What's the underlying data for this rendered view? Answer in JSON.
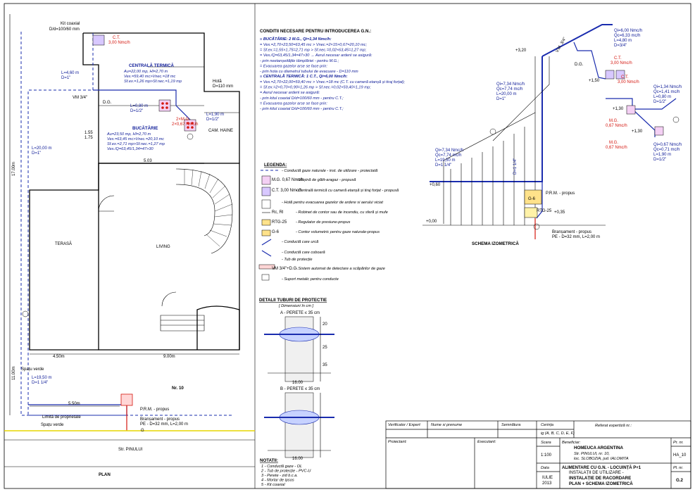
{
  "conditions": {
    "title": "CONDITII NECESARE PENTRU INTRODUCEREA G.N.:",
    "kitchen_head": "≡ BUCĂTĂRIE: 2 M.G., Qi=1,34 Nmc/h:",
    "kitchen_lines": [
      "= Vex.=2,70×23,50=63,45 mc > Vnec.=2×15×0,67=20,10 mc;",
      "= Sf.ex.=1,55×1,75=2,71 mp > Sf.nec.=0,02×63,45=1,27 mp;",
      "= Vex./Q=63,45/1,34=47>30 → Aerul necesar arderii se asigură:",
      "- prin neetanșeitățile tâmplăriei - pentru M.G.;",
      "= Evacuarea gazelor arse se face prin:",
      "- prin hota cu diametrul tubului de evacuare - D=110 mm"
    ],
    "boiler_head": "≡ CENTRALĂ TERMICĂ: 1 C.T., Qi=6,00 Nmc/h:",
    "boiler_lines": [
      "= Vex.=2,70×22,00=59,40 mc > Vnec.=18 mc (C.T. cu cameră etanșă și tiraj forțat);",
      "= Sf.ex.=2×0,70×0,90=1,26 mp > Sf.nec.=0,02×59,40=1,19 mp;",
      "= Aerul necesar arderii se asigură:",
      "- prin kitul coaxial D/d=100/60 mm - pentru C.T.;",
      "= Evacuarea gazelor arse se face prin:",
      "- prin kitul coaxial D/d=100/60 mm - pentru C.T.;"
    ]
  },
  "legend": {
    "title": "LEGENDA:",
    "items": [
      {
        "symbol": "",
        "text": "- Conductă gaze naturale - inst. de utilizare - proiectată"
      },
      {
        "symbol": "M.G. 0,67 Nmc/h",
        "text": "- Mașină de gătit-aragaz - propusă"
      },
      {
        "symbol": "C.T. 3,00 Nmc/h",
        "text": "- Centrală termică cu cameră etanșă și tiraj forțat - propusă"
      },
      {
        "symbol": "",
        "text": "- Hotă pentru evacuarea gazelor de ardere si aerului viciat"
      },
      {
        "symbol": "Rc, Rl",
        "text": "- Robinet de contor sau de incendiu, cu sferă și mufe"
      },
      {
        "symbol": "RTG-25",
        "text": "- Regulator de presiune-propus"
      },
      {
        "symbol": "G-6",
        "text": "- Contor volumetric pentru gaze naturale-propus"
      },
      {
        "symbol": "",
        "text": "- Conductă care urcă"
      },
      {
        "symbol": "",
        "text": "- Conductă care coboară"
      },
      {
        "symbol": "",
        "text": "- Tub de protecție"
      },
      {
        "symbol": "VM 3/4\"+D.G.",
        "text": "- Sistem automat de detectare a scăpărilor de gaze"
      },
      {
        "symbol": "",
        "text": "- Suport metalic pentru conducte"
      }
    ]
  },
  "details": {
    "title": "DETALII TUBURI DE PROTECTIE",
    "subtitle": "[ Dimensiuni în cm ]",
    "a_title": "A - PERETE ≤ 35 cm",
    "b_title": "B - PERETE ≤ 35 cm",
    "dims": [
      "20",
      "25",
      "35",
      "16.00"
    ]
  },
  "notes": {
    "title": "NOTATII:",
    "items": [
      "1 - Conductă gaze - OL",
      "2 - Tub de protecție - PVC-U",
      "3 - Perete - zid b.c.a.",
      "4 - Mortar de ipsos",
      "5 - Kit coaxial"
    ]
  },
  "plan": {
    "title": "PLAN",
    "street": "Str. PINULUI",
    "house_no": "Nr. 10",
    "property_limit": "Limită de proprietate",
    "green1": "Spațu verde",
    "green2": "Spațu verde",
    "prm": "P.R.M. - propus",
    "branch": "Branșament - propus",
    "branch_spec": "PE - D=32 mm, L=2,00 m",
    "g_label": "G",
    "kit": "Kit coaxial",
    "kit_dim": "D/d=100/60 mm",
    "vm": "VM 3/4\"",
    "dg": "D.G.",
    "hota": "Hotă",
    "hota_d": "D=110 mm",
    "ct_label": "C.T.",
    "ct_val": "3,00 Nmc/h",
    "mg_label": "2×M.G.",
    "mg_val": "2×0,67 Nmc/h",
    "central_room": "CENTRALĂ TERMICĂ",
    "central_lines": [
      "Au=22,00 mp, Hl=2,70 m",
      "Vex.=59,40 mc>Vnec.=18 mc",
      "Sf.ex.=1,26 mp>Sf.nec.=1,19 mp"
    ],
    "kitchen_room": "BUCĂTĂRIE",
    "kitchen_lines": [
      "Au=23,50 mp, Hl=2,70 m",
      "Vex.=63,45 mc>Vnec.=20,10 mc",
      "Sf.ex.=2,71 mp>Sf.nec.=1,27 mp",
      "Vex./Q=63,45/1,34=47>30"
    ],
    "closet": "CAM. HAINE",
    "terrace": "TERASĂ",
    "living": "LIVING",
    "dim_450": "4.50m",
    "dim_900": "9.00m",
    "dim_550": "5.50m",
    "dim_1100": "11.00m",
    "dim_1700": "17.00m",
    "dim_503": "5.03",
    "dim_155": "1.55",
    "dim_175": "1.75",
    "l_460": "L=4,60 m",
    "l_080": "L=0,80 m",
    "l_190": "L=1,90 m",
    "l_2000": "L=20,00 m",
    "l_1950": "L=19,50 m",
    "d1": "D=1\"",
    "d114": "D=1 1/4\"",
    "d12": "D=1/2\""
  },
  "iso": {
    "title": "SCHEMA IZOMETRICĂ",
    "q_top": "Qi=6,00 Nmc/h",
    "qc_top": "Qc=6,33 mc/h",
    "l_top": "L=4,80 m",
    "d_top": "D=3/4\"",
    "ct": "C.T.",
    "ct_val": "3,00 Nmc/h",
    "ct2": "C.T.",
    "ct2_val": "3,00 Nmc/h",
    "q_mid": "Qi=7,34 Nmc/h",
    "qc_mid": "Qc=7,74 mc/h",
    "l_mid": "L=20,00 m",
    "d_mid": "D=1\"",
    "q_left": "Qi=7,34 Nmc/h",
    "qc_left": "Qc=7,74 mc/h",
    "l_left": "L=19,50 m",
    "d_left": "D=1 1/4\"",
    "q_right1": "Qi=1,34 Nmc/h",
    "qc_right1": "Qc=1,41 mc/h",
    "l_right1": "L=0,80 m",
    "d_right1": "D=1/2\"",
    "q_right2": "Qi=0,67 Nmc/h",
    "qc_right2": "Qc=0,71 mc/h",
    "l_right2": "L=1,90 m",
    "d_right2": "D=1/2\"",
    "mg": "M.G.",
    "mg_val": "0,67 Nmc/h",
    "prm": "P.R.M. - propus",
    "g6": "G-6",
    "rtg": "RTG-25",
    "branch": "Branșament - propus",
    "branch_spec": "PE - D=32 mm, L=2,00 m",
    "lv_320": "+3,20",
    "lv_150": "+1,50",
    "lv_130": "+1,30",
    "lv_130b": "+1,30",
    "lv_060": "+0,60",
    "lv_000": "+0,00",
    "lv_035": "+0,35",
    "vm": "V.M. 3/4\"",
    "dg": "D.G.",
    "d114": "D=1 1/4\""
  },
  "title_block": {
    "verificator": "Verificator / Expert",
    "nume": "Nume si prenume",
    "semnatura": "Semnătura",
    "cerinta": "Cerința",
    "cerinta_val": "ig (A, B, C, D, E, F)",
    "referat": "Referat expertiză nr.:",
    "proiectant": "Proiectant:",
    "executant": "Executant:",
    "scara": "Scara",
    "scara_val": "1:100",
    "beneficiar": "Beneficiar:",
    "ben_name": "HOMEUCA ARGENTINA",
    "ben_addr1": "Str. PINULUI, nr. 10,",
    "ben_addr2": "loc. SLOBOZIA, jud. IALOMITA",
    "pr_nr": "Pr. nr.",
    "pr_val": "HA_10",
    "data": "Data",
    "data_val1": "IULIE",
    "data_val2": "2013",
    "titlu1": "ALIMENTARE CU G.N. - LOCUINȚĂ P+1",
    "titlu2": "INSTALAȚII DE UTILIZARE -",
    "titlu3": "INSTALAȚIE DE RACORDARE",
    "titlu4": "PLAN + SCHEMA IZOMETRICĂ",
    "pl_nr": "Pl. nr.",
    "pl_val": "G.2"
  }
}
